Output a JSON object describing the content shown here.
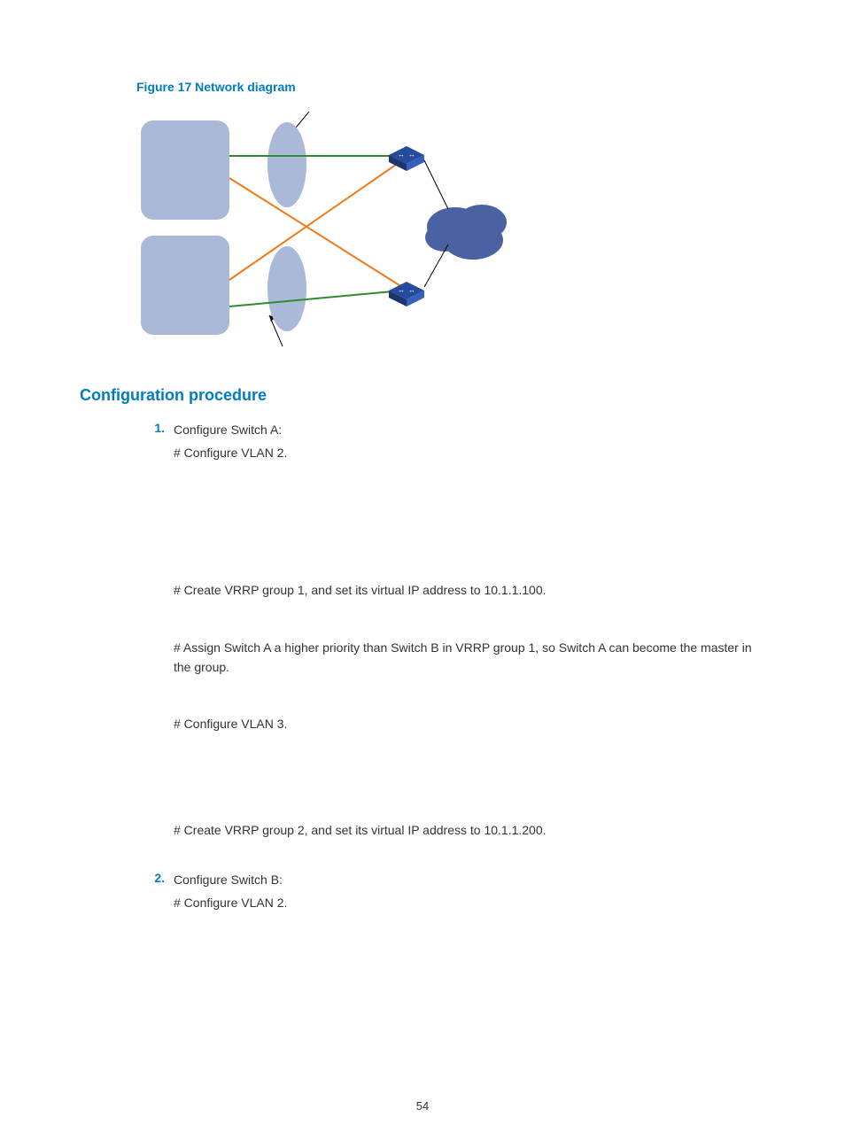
{
  "figure_caption": "Figure 17 Network diagram",
  "section_heading": "Configuration procedure",
  "step1_num": "1.",
  "step1_title": "Configure Switch A:",
  "step1_l1": "# Configure VLAN 2.",
  "step1_l2": "# Create VRRP group 1, and set its virtual IP address to 10.1.1.100.",
  "step1_l3": "# Assign Switch A a higher priority than Switch B in VRRP group 1, so Switch A can become the master in the group.",
  "step1_l4": "# Configure VLAN 3.",
  "step1_l5": "# Create VRRP group 2, and set its virtual IP address to 10.1.1.200.",
  "step2_num": "2.",
  "step2_title": "Configure Switch B:",
  "step2_l1": "# Configure VLAN 2.",
  "page_number": "54"
}
